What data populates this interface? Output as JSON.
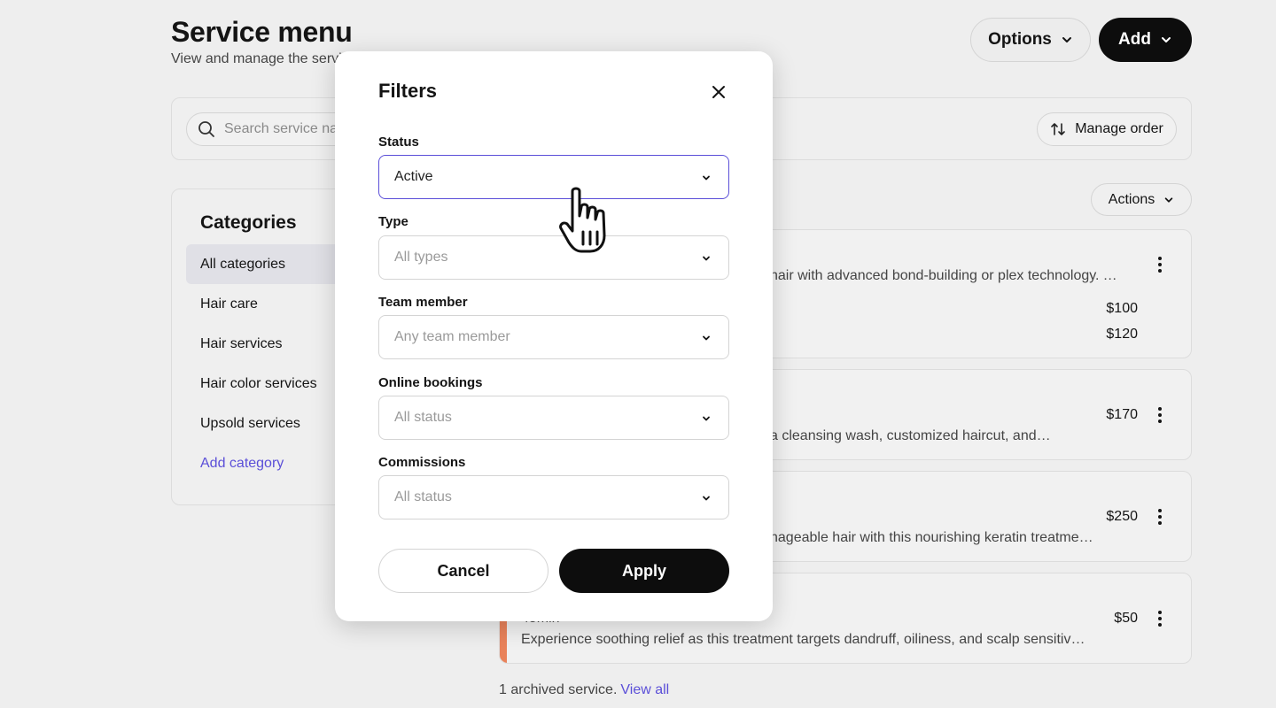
{
  "header": {
    "title": "Service menu",
    "subtitle": "View and manage the services",
    "options_label": "Options",
    "add_label": "Add"
  },
  "toolbar": {
    "search_placeholder": "Search service name",
    "manage_order_label": "Manage order"
  },
  "categories": {
    "title": "Categories",
    "items": [
      {
        "label": "All categories",
        "active": true
      },
      {
        "label": "Hair care"
      },
      {
        "label": "Hair services"
      },
      {
        "label": "Hair color services"
      },
      {
        "label": "Upsold services"
      },
      {
        "label": "Add category",
        "link": true
      }
    ]
  },
  "actions_label": "Actions",
  "services": [
    {
      "desc": "hair with advanced bond-building or plex technology. This …",
      "prices": [
        "$100",
        "$120"
      ]
    },
    {
      "desc": "a cleansing wash, customized haircut, and a …",
      "price": "$170"
    },
    {
      "desc": "nageable hair with this nourishing keratin treatment.…",
      "price": "$250"
    },
    {
      "duration": "45min",
      "desc": "Experience soothing relief as this treatment targets dandruff, oiliness, and scalp sensitivity. …",
      "price": "$50",
      "accent_color": "#e9825a"
    }
  ],
  "archived": {
    "text": "1 archived service.",
    "link": "View all"
  },
  "modal": {
    "title": "Filters",
    "fields": [
      {
        "label": "Status",
        "value": "Active",
        "placeholder": false
      },
      {
        "label": "Type",
        "value": "All types",
        "placeholder": true
      },
      {
        "label": "Team member",
        "value": "Any team member",
        "placeholder": true
      },
      {
        "label": "Online bookings",
        "value": "All status",
        "placeholder": true
      },
      {
        "label": "Commissions",
        "value": "All status",
        "placeholder": true
      }
    ],
    "cancel_label": "Cancel",
    "apply_label": "Apply"
  },
  "colors": {
    "accent": "#5b4fd8",
    "primary_button": "#0d0d0d",
    "service_accent": "#e9825a"
  },
  "icons": [
    "search-icon",
    "chevron-down-icon",
    "sort-icon",
    "close-icon",
    "more-vertical-icon",
    "hand-pointer-cursor-icon"
  ]
}
